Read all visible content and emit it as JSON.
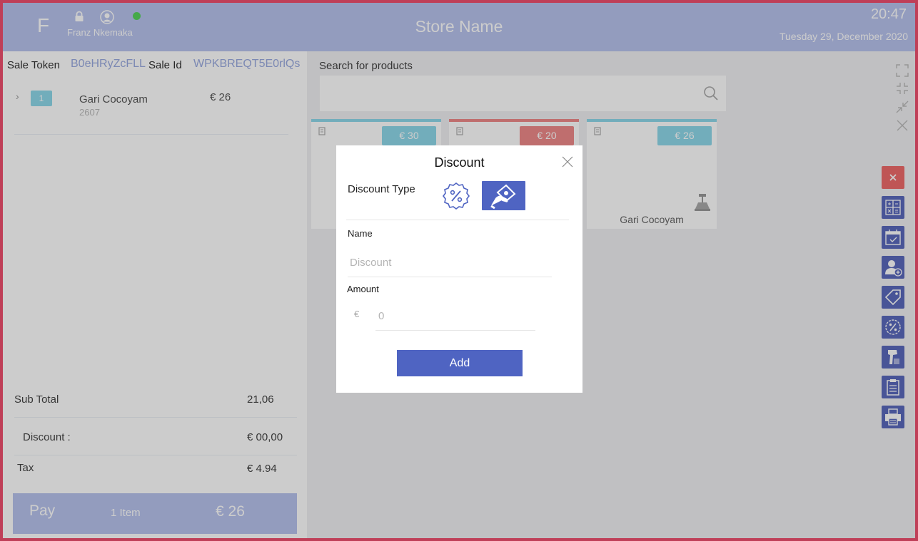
{
  "header": {
    "logo_letter": "F",
    "user_name": "Franz Nkemaka",
    "store_name": "Store Name",
    "time": "20:47",
    "date": "Tuesday 29, December  2020",
    "online_status_color": "#57d45c"
  },
  "sale": {
    "token_label": "Sale Token",
    "token_value": "B0eHRyZcFLL",
    "id_label": "Sale  Id",
    "id_value": "WPKBREQT5E0rlQs"
  },
  "cart": {
    "items": [
      {
        "qty": "1",
        "name": "Gari Cocoyam",
        "code": "2607",
        "price": "€ 26"
      }
    ]
  },
  "totals": {
    "subtotal_label": "Sub Total",
    "subtotal_value": "21,06",
    "discount_label": "Discount :",
    "discount_value": "€ 00,00",
    "tax_label": "Tax",
    "tax_value": "€ 4.94"
  },
  "pay": {
    "label": "Pay",
    "items": "1 Item",
    "total": "€ 26"
  },
  "search": {
    "label": "Search for products",
    "placeholder": ""
  },
  "products": [
    {
      "price": "€ 30",
      "accent": "#8fd9ea",
      "name": ""
    },
    {
      "price": "€ 20",
      "accent": "#ef8a8a",
      "name": ""
    },
    {
      "price": "€ 26",
      "accent": "#8fd9ea",
      "name": "Gari Cocoyam"
    }
  ],
  "toolbar": {
    "top_icons": [
      "expand-icon",
      "compress-icon",
      "minimize-icon",
      "close-icon"
    ],
    "buttons": [
      "cancel-sale-icon",
      "calculator-icon",
      "calendar-icon",
      "add-customer-icon",
      "tag-icon",
      "percent-icon",
      "barcode-scanner-icon",
      "clipboard-icon",
      "printer-icon"
    ],
    "cancel_color": "#ef6b6b",
    "button_color": "#5b69bd"
  },
  "modal": {
    "title": "Discount",
    "type_label": "Discount Type",
    "name_label": "Name",
    "name_placeholder": "Discount",
    "amount_label": "Amount",
    "currency": "€",
    "amount_placeholder": "0",
    "add_label": "Add",
    "accent": "#4f64c2",
    "selected_type": "cash"
  }
}
